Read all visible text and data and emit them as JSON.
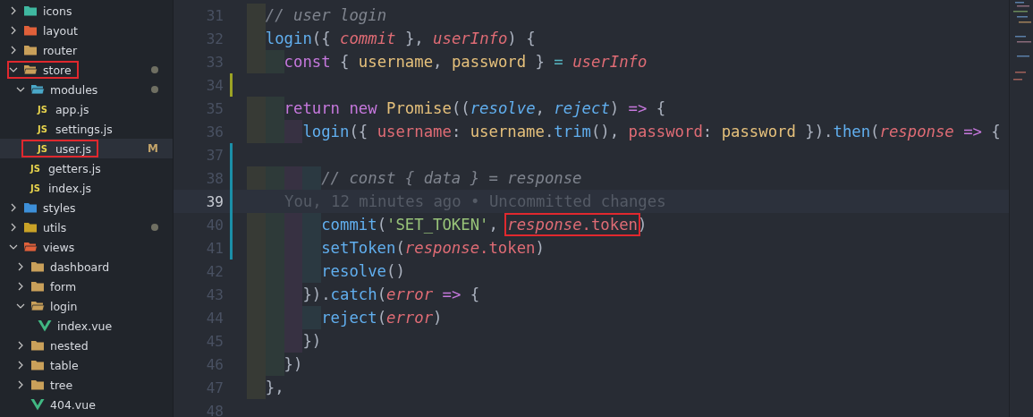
{
  "explorer": {
    "items": [
      {
        "name": "icons",
        "kind": "folder",
        "color": "#3fb8a0",
        "expanded": false,
        "selected": false,
        "highlighted": false,
        "modified": false
      },
      {
        "name": "layout",
        "kind": "folder",
        "color": "#e0603a",
        "expanded": false,
        "selected": false,
        "highlighted": false,
        "modified": false
      },
      {
        "name": "router",
        "kind": "folder",
        "color": "#c9a05a",
        "expanded": false,
        "selected": false,
        "highlighted": false,
        "modified": false
      },
      {
        "name": "store",
        "kind": "folder",
        "color": "#c9a05a",
        "expanded": true,
        "selected": false,
        "highlighted": true,
        "modified": true,
        "children": [
          {
            "name": "modules",
            "kind": "folder",
            "color": "#4aa8c8",
            "expanded": true,
            "selected": false,
            "highlighted": false,
            "modified": true,
            "children": [
              {
                "name": "app.js",
                "kind": "js",
                "icon_text": "JS",
                "selected": false,
                "highlighted": false,
                "modified": false
              },
              {
                "name": "settings.js",
                "kind": "js",
                "icon_text": "JS",
                "selected": false,
                "highlighted": false,
                "modified": false
              },
              {
                "name": "user.js",
                "kind": "js",
                "icon_text": "JS",
                "selected": true,
                "highlighted": true,
                "modified": false,
                "badge": "M"
              }
            ]
          },
          {
            "name": "getters.js",
            "kind": "js",
            "icon_text": "JS",
            "selected": false,
            "highlighted": false,
            "modified": false
          },
          {
            "name": "index.js",
            "kind": "js",
            "icon_text": "JS",
            "selected": false,
            "highlighted": false,
            "modified": false
          }
        ]
      },
      {
        "name": "styles",
        "kind": "folder",
        "color": "#3d8fd8",
        "expanded": false,
        "selected": false,
        "highlighted": false,
        "modified": false
      },
      {
        "name": "utils",
        "kind": "folder",
        "color": "#c9a227",
        "expanded": false,
        "selected": false,
        "highlighted": false,
        "modified": true
      },
      {
        "name": "views",
        "kind": "folder",
        "color": "#e0603a",
        "expanded": true,
        "selected": false,
        "highlighted": false,
        "modified": false,
        "children": [
          {
            "name": "dashboard",
            "kind": "folder",
            "color": "#c9a05a",
            "expanded": false,
            "selected": false,
            "highlighted": false,
            "modified": false
          },
          {
            "name": "form",
            "kind": "folder",
            "color": "#c9a05a",
            "expanded": false,
            "selected": false,
            "highlighted": false,
            "modified": false
          },
          {
            "name": "login",
            "kind": "folder",
            "color": "#c9a05a",
            "expanded": true,
            "selected": false,
            "highlighted": false,
            "modified": false,
            "children": [
              {
                "name": "index.vue",
                "kind": "vue",
                "selected": false,
                "highlighted": false,
                "modified": false
              }
            ]
          },
          {
            "name": "nested",
            "kind": "folder",
            "color": "#c9a05a",
            "expanded": false,
            "selected": false,
            "highlighted": false,
            "modified": false
          },
          {
            "name": "table",
            "kind": "folder",
            "color": "#c9a05a",
            "expanded": false,
            "selected": false,
            "highlighted": false,
            "modified": false
          },
          {
            "name": "tree",
            "kind": "folder",
            "color": "#c9a05a",
            "expanded": false,
            "selected": false,
            "highlighted": false,
            "modified": false
          },
          {
            "name": "404.vue",
            "kind": "vue",
            "selected": false,
            "highlighted": false,
            "modified": false
          }
        ]
      }
    ]
  },
  "editor": {
    "lines": [
      {
        "number": "31",
        "current": false,
        "tokens": [
          {
            "text": "  // user login",
            "kind": "comment"
          }
        ]
      },
      {
        "number": "32",
        "current": false,
        "tokens": [
          {
            "text": "  login",
            "kind": "func"
          },
          {
            "text": "({ ",
            "kind": "punct"
          },
          {
            "text": "commit",
            "kind": "param"
          },
          {
            "text": " }, ",
            "kind": "punct"
          },
          {
            "text": "userInfo",
            "kind": "param"
          },
          {
            "text": ") {",
            "kind": "punct"
          }
        ]
      },
      {
        "number": "33",
        "current": false,
        "tokens": [
          {
            "text": "    const",
            "kind": "keyword"
          },
          {
            "text": " { ",
            "kind": "punct"
          },
          {
            "text": "username",
            "kind": "var"
          },
          {
            "text": ", ",
            "kind": "punct"
          },
          {
            "text": "password",
            "kind": "var"
          },
          {
            "text": " } ",
            "kind": "punct"
          },
          {
            "text": "= ",
            "kind": "operator"
          },
          {
            "text": "userInfo",
            "kind": "param"
          }
        ]
      },
      {
        "number": "34",
        "current": false,
        "gutter": {
          "kind": "modified"
        }
      },
      {
        "number": "35",
        "current": false,
        "tokens": [
          {
            "text": "    return new ",
            "kind": "keyword"
          },
          {
            "text": "Promise",
            "kind": "var"
          },
          {
            "text": "((",
            "kind": "punct"
          },
          {
            "text": "resolve",
            "kind": "arg"
          },
          {
            "text": ", ",
            "kind": "punct"
          },
          {
            "text": "reject",
            "kind": "arg"
          },
          {
            "text": ") ",
            "kind": "punct"
          },
          {
            "text": "=>",
            "kind": "keyword"
          },
          {
            "text": " {",
            "kind": "punct"
          }
        ]
      },
      {
        "number": "36",
        "current": false,
        "tokens": [
          {
            "text": "      login",
            "kind": "func"
          },
          {
            "text": "({ ",
            "kind": "punct"
          },
          {
            "text": "username",
            "kind": "prop"
          },
          {
            "text": ": ",
            "kind": "punct"
          },
          {
            "text": "username",
            "kind": "var"
          },
          {
            "text": ".",
            "kind": "punct"
          },
          {
            "text": "trim",
            "kind": "func"
          },
          {
            "text": "(), ",
            "kind": "punct"
          },
          {
            "text": "password",
            "kind": "prop"
          },
          {
            "text": ": ",
            "kind": "punct"
          },
          {
            "text": "password",
            "kind": "var"
          },
          {
            "text": " }).",
            "kind": "punct"
          },
          {
            "text": "then",
            "kind": "func"
          },
          {
            "text": "(",
            "kind": "punct"
          },
          {
            "text": "response",
            "kind": "param"
          },
          {
            "text": " =>",
            "kind": "keyword"
          },
          {
            "text": " {",
            "kind": "punct"
          }
        ]
      },
      {
        "number": "37",
        "current": false,
        "gutter": {
          "kind": "added"
        }
      },
      {
        "number": "38",
        "current": false,
        "gutter": {
          "kind": "added"
        },
        "tokens": [
          {
            "text": "        // const { data } = response",
            "kind": "comment"
          }
        ]
      },
      {
        "number": "39",
        "current": true,
        "gutter": {
          "kind": "added"
        },
        "blame": "You, 12 minutes ago • Uncommitted changes"
      },
      {
        "number": "40",
        "current": false,
        "gutter": {
          "kind": "added"
        },
        "tokens": [
          {
            "text": "        commit",
            "kind": "func"
          },
          {
            "text": "(",
            "kind": "punct"
          },
          {
            "text": "'SET_TOKEN'",
            "kind": "string"
          },
          {
            "text": ", ",
            "kind": "punct"
          },
          {
            "text": "response",
            "kind": "param",
            "highlighted": true
          },
          {
            "text": ".token",
            "kind": "prop",
            "highlighted": true
          },
          {
            "text": ")",
            "kind": "punct"
          }
        ]
      },
      {
        "number": "41",
        "current": false,
        "gutter": {
          "kind": "added"
        },
        "tokens": [
          {
            "text": "        setToken",
            "kind": "func"
          },
          {
            "text": "(",
            "kind": "punct"
          },
          {
            "text": "response",
            "kind": "param"
          },
          {
            "text": ".token",
            "kind": "prop"
          },
          {
            "text": ")",
            "kind": "punct"
          }
        ]
      },
      {
        "number": "42",
        "current": false,
        "tokens": [
          {
            "text": "        resolve",
            "kind": "func"
          },
          {
            "text": "()",
            "kind": "punct"
          }
        ]
      },
      {
        "number": "43",
        "current": false,
        "tokens": [
          {
            "text": "      }).",
            "kind": "punct"
          },
          {
            "text": "catch",
            "kind": "func"
          },
          {
            "text": "(",
            "kind": "punct"
          },
          {
            "text": "error",
            "kind": "param"
          },
          {
            "text": " =>",
            "kind": "keyword"
          },
          {
            "text": " {",
            "kind": "punct"
          }
        ]
      },
      {
        "number": "44",
        "current": false,
        "tokens": [
          {
            "text": "        reject",
            "kind": "func"
          },
          {
            "text": "(",
            "kind": "punct"
          },
          {
            "text": "error",
            "kind": "param"
          },
          {
            "text": ")",
            "kind": "punct"
          }
        ]
      },
      {
        "number": "45",
        "current": false,
        "tokens": [
          {
            "text": "      })",
            "kind": "punct"
          }
        ]
      },
      {
        "number": "46",
        "current": false,
        "tokens": [
          {
            "text": "    })",
            "kind": "punct"
          }
        ]
      },
      {
        "number": "47",
        "current": false,
        "tokens": [
          {
            "text": "  },",
            "kind": "punct"
          }
        ]
      },
      {
        "number": "48",
        "current": false
      }
    ]
  }
}
